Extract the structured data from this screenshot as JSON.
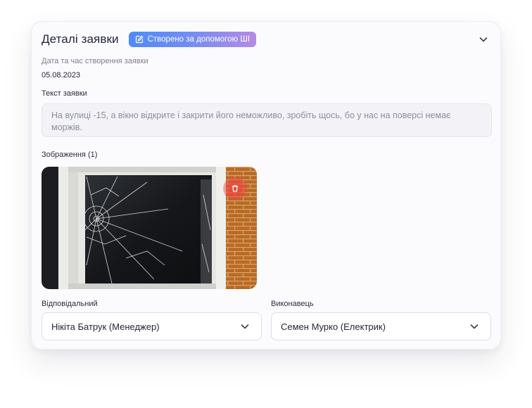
{
  "header": {
    "title": "Деталі заявки",
    "ai_badge": "Створено за допомогою ШІ",
    "ai_badge_icon": "edit-square-icon",
    "collapse_icon": "chevron-down-icon"
  },
  "created": {
    "label": "Дата та час створення заявки",
    "value": "05.08.2023"
  },
  "request_text": {
    "label": "Текст заявки",
    "value": "На вулиці -15, а вікно відкрите і закрити його неможливо, зробіть щось, бо у нас на поверсі немає моржів."
  },
  "images": {
    "label": "Зображення",
    "count": "(1)",
    "delete_icon": "trash-icon"
  },
  "responsible": {
    "label": "Відповідальний",
    "value": "Нікіта Батрук (Менеджер)"
  },
  "executor": {
    "label": "Виконавець",
    "value": "Семен Мурко (Електрик)"
  },
  "colors": {
    "badge_gradient_start": "#4f8bf7",
    "badge_gradient_end": "#b58be6",
    "delete_red": "#f03c3c"
  }
}
